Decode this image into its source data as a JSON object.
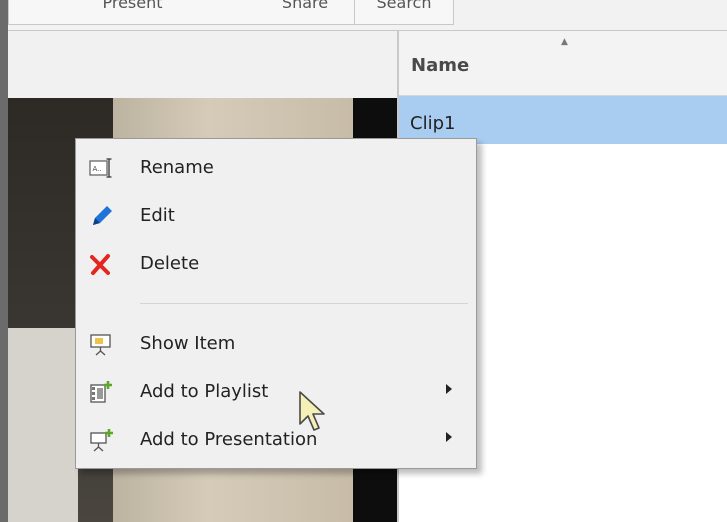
{
  "tabs": [
    {
      "label": "Present"
    },
    {
      "label": "Share"
    },
    {
      "label": "Search"
    }
  ],
  "list": {
    "sort_indicator": "▲",
    "column_header": "Name",
    "selected_row": "Clip1"
  },
  "context_menu": {
    "items": [
      {
        "label": "Rename",
        "icon": "rename-icon"
      },
      {
        "label": "Edit",
        "icon": "pencil-icon"
      },
      {
        "label": "Delete",
        "icon": "delete-x-icon"
      },
      {
        "label": "Show Item",
        "icon": "presentation-screen-icon"
      },
      {
        "label": "Add to Playlist",
        "icon": "add-playlist-icon",
        "submenu": true
      },
      {
        "label": "Add to Presentation",
        "icon": "add-presentation-icon",
        "submenu": true
      }
    ]
  },
  "colors": {
    "selection": "#a9cdf0",
    "menu_bg": "#f0f0f0",
    "edit_icon": "#1e73d8",
    "delete_icon": "#e3261f",
    "add_icon": "#5aa829"
  }
}
